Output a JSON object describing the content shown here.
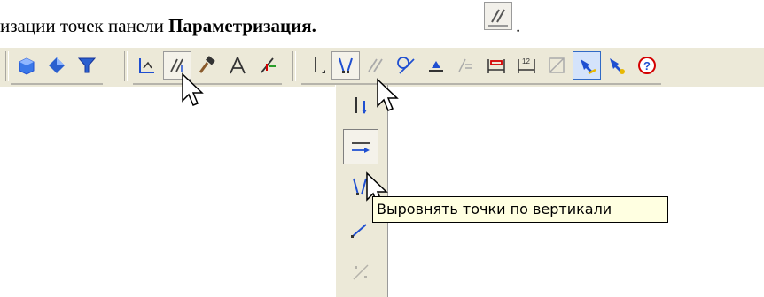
{
  "document": {
    "text_prefix": "изации точек панели ",
    "text_bold": "Параметризация.",
    "period": "."
  },
  "toolbar": {
    "groups": [
      {
        "name": "view-group",
        "icons": [
          "cube-icon",
          "diamond-icon",
          "filter-icon"
        ]
      },
      {
        "name": "parametrization-group",
        "icons": [
          "fix-point-icon",
          "parallel-lines-icon",
          "hammer-icon",
          "compass-icon",
          "angle-icon"
        ]
      },
      {
        "name": "constraints-group",
        "icons": [
          "vertical-align-icon",
          "align-vertical-points-icon",
          "parallel-icon",
          "tangent-icon",
          "point-on-curve-icon",
          "equal-icon",
          "horizontal-dimension-icon",
          "dimension-12-icon",
          "bounding-box-icon",
          "highlight-icon",
          "analyze-icon",
          "help-icon"
        ]
      }
    ],
    "dimension_label": "12"
  },
  "flyout": {
    "items": [
      "align-vertical-down-icon",
      "align-horizontal-arrow-icon",
      "align-vertical-points-icon",
      "align-diagonal-icon",
      "align-disabled-icon"
    ]
  },
  "tooltip": {
    "text": "Выровнять точки по вертикали"
  },
  "colors": {
    "toolbar_bg": "#ece9d8",
    "tooltip_bg": "#ffffe1",
    "icon_blue": "#1f4fd1",
    "icon_red": "#d40000"
  }
}
